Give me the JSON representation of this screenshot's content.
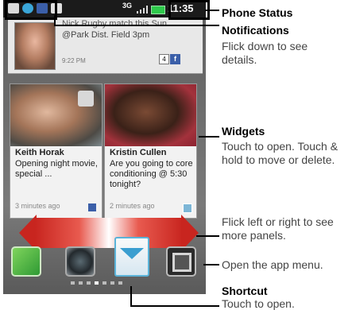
{
  "status_bar": {
    "network": "3G",
    "time": "11:35"
  },
  "notification": {
    "line1": "Nick Rugby match this Sun.",
    "line2": "@Park Dist. Field 3pm",
    "time": "9:22 PM",
    "count": "4",
    "source_icon": "f"
  },
  "widgets": [
    {
      "name": "Keith Horak",
      "text": "Opening night movie, special ...",
      "time": "3 minutes ago"
    },
    {
      "name": "Kristin Cullen",
      "text": "Are you going to core conditioning @ 5:30 tonight?",
      "time": "2 minutes ago"
    }
  ],
  "callouts": {
    "phone_status": {
      "title": "Phone Status"
    },
    "notifications": {
      "title": "Notifications",
      "text1": "Flick down to see",
      "text2": "details."
    },
    "widgets": {
      "title": "Widgets",
      "text1": "Touch to open. Touch &",
      "text2": "hold to move or delete."
    },
    "flick": {
      "text1": "Flick left or right to see",
      "text2": "more panels."
    },
    "app_menu": {
      "text1": "Open the app menu."
    },
    "shortcut": {
      "title": "Shortcut",
      "text1": "Touch to open."
    }
  },
  "colors": {
    "flick_bar": "#c8251f",
    "battery": "#2ec94b",
    "facebook": "#3b5fa8"
  },
  "icons": [
    "message-icon",
    "sync-icon",
    "facebook-icon",
    "play-icon",
    "signal-icon",
    "battery-icon",
    "dialer-icon",
    "camera-icon",
    "messaging-icon",
    "app-menu-icon"
  ]
}
